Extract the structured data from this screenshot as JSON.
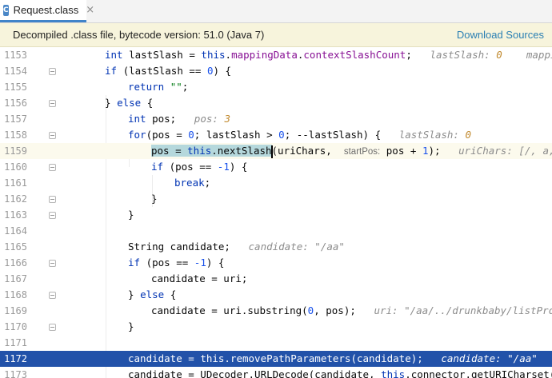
{
  "tab": {
    "icon_text": "C",
    "label": "Request.class",
    "close": "×"
  },
  "banner": {
    "message": "Decompiled .class file, bytecode version: 51.0 (Java 7)",
    "action": "Download Sources"
  },
  "editor": {
    "line_numbers": [
      "1153",
      "1154",
      "1155",
      "1156",
      "1157",
      "1158",
      "1159",
      "1160",
      "1161",
      "1162",
      "1163",
      "1164",
      "1165",
      "1166",
      "1167",
      "1168",
      "1169",
      "1170",
      "1171",
      "1172",
      "1173"
    ],
    "l1153": {
      "a": "int",
      "b": " lastSlash = ",
      "c": "this",
      "d": ".",
      "e": "mappingData",
      "f": ".",
      "g": "contextSlashCount",
      "h": ";",
      "hint1": "lastSlash: ",
      "hint1v": "0",
      "hint2": "mappingDa"
    },
    "l1154": {
      "a": "if",
      "b": " (lastSlash == ",
      "c": "0",
      "d": ") {"
    },
    "l1155": {
      "a": "return",
      "b": " ",
      "c": "\"\"",
      "d": ";"
    },
    "l1156": {
      "a": "} ",
      "b": "else",
      "c": " {"
    },
    "l1157": {
      "a": "int",
      "b": " pos;",
      "hint1": "pos: ",
      "hint1v": "3"
    },
    "l1158": {
      "a": "for",
      "b": "(pos = ",
      "c": "0",
      "d": "; lastSlash > ",
      "e": "0",
      "f": "; --lastSlash) {",
      "hint1": "lastSlash: ",
      "hint1v": "0"
    },
    "l1159": {
      "a": "pos = ",
      "b": "this",
      "c": ".nextSlash",
      "d": "(uriChars, ",
      "param": "startPos:",
      "e": " pos + ",
      "f": "1",
      "g": ");",
      "hint1": "uriChars: [/, a, a, /"
    },
    "l1160": {
      "a": "if",
      "b": " (pos == ",
      "c": "-1",
      "d": ") {"
    },
    "l1161": {
      "a": "break",
      "b": ";"
    },
    "l1162": {
      "a": "}"
    },
    "l1163": {
      "a": "}"
    },
    "l1164": {},
    "l1165": {
      "a": "String candidate;",
      "hint1": "candidate: \"/aa\""
    },
    "l1166": {
      "a": "if",
      "b": " (pos == ",
      "c": "-1",
      "d": ") {"
    },
    "l1167": {
      "a": "candidate = uri;"
    },
    "l1168": {
      "a": "} ",
      "b": "else",
      "c": " {"
    },
    "l1169": {
      "a": "candidate = uri.substring(",
      "b": "0",
      "c": ", pos);",
      "hint1": "uri: \"/aa/../drunkbaby/listProduct"
    },
    "l1170": {
      "a": "}"
    },
    "l1171": {},
    "l1172": {
      "a": "candidate = ",
      "b": "this",
      "c": ".removePathParameters(candidate);",
      "hint1": "candidate: \"/aa\""
    },
    "l1173": {
      "a": "candidate = UDecoder.URLDecode(candidate, ",
      "b": "this",
      "c": ".connector.getURICharset());"
    }
  },
  "colors": {
    "accent": "#4083c9",
    "banner_bg": "#f7f4dc",
    "link": "#2a7fb3",
    "selection": "#2252a9",
    "keyword": "#0033b3",
    "field": "#871094",
    "number": "#1750eb",
    "string": "#067d17"
  }
}
